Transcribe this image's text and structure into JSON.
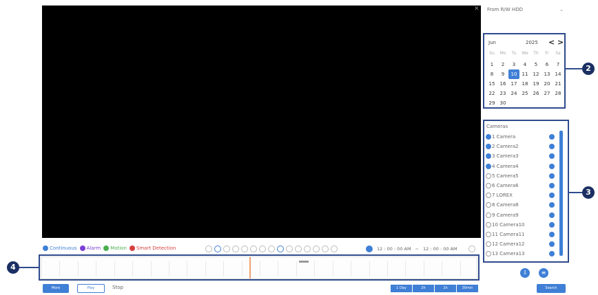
{
  "source": {
    "label": "From R/W HDD",
    "chevron": "chevron-down-icon"
  },
  "calendar": {
    "month": "Jun",
    "year": "2025",
    "prev": "<",
    "next": ">",
    "weekdays": [
      "Su",
      "Mo",
      "Tu",
      "We",
      "Th",
      "Fr",
      "Sa"
    ],
    "days": [
      "1",
      "2",
      "3",
      "4",
      "5",
      "6",
      "7",
      "8",
      "9",
      "10",
      "11",
      "12",
      "13",
      "14",
      "15",
      "16",
      "17",
      "18",
      "19",
      "20",
      "21",
      "22",
      "23",
      "24",
      "25",
      "26",
      "27",
      "28",
      "29",
      "30"
    ],
    "selected_day": "10"
  },
  "cameras": {
    "title": "Cameras",
    "items": [
      {
        "label": "1 Camera",
        "checked": true
      },
      {
        "label": "2 Camera2",
        "checked": true
      },
      {
        "label": "3 Camera3",
        "checked": true
      },
      {
        "label": "4 Camera4",
        "checked": true
      },
      {
        "label": "5 Camera5",
        "checked": false
      },
      {
        "label": "6 Camera6",
        "checked": false
      },
      {
        "label": "7 LOREX",
        "checked": false
      },
      {
        "label": "8 Camera8",
        "checked": false
      },
      {
        "label": "9 Camera9",
        "checked": false
      },
      {
        "label": "10 Camera10",
        "checked": false
      },
      {
        "label": "11 Camera11",
        "checked": false
      },
      {
        "label": "12 Camera12",
        "checked": false
      },
      {
        "label": "13 Camera13",
        "checked": false
      }
    ]
  },
  "legend": [
    {
      "label": "Continuous",
      "color": "#3f7fd6"
    },
    {
      "label": "Alarm",
      "color": "#7b3fd6"
    },
    {
      "label": "Motion",
      "color": "#4caf50"
    },
    {
      "label": "Smart Detection",
      "color": "#d63f3f"
    }
  ],
  "time_range": {
    "start": "12 : 00 : 00 AM",
    "separator": "~",
    "end": "12 : 00 : 00 AM"
  },
  "callouts": [
    "2",
    "3",
    "4"
  ],
  "bottom": {
    "more_label": "More",
    "play_label": "Play",
    "stop_label": "Stop",
    "zoom": [
      "1 Day",
      "2h",
      "1h",
      "30min"
    ],
    "search_label": "Search"
  },
  "colors": {
    "accent": "#3f7fd6",
    "callout": "#2e4a8c",
    "badge": "#1b2f63"
  }
}
